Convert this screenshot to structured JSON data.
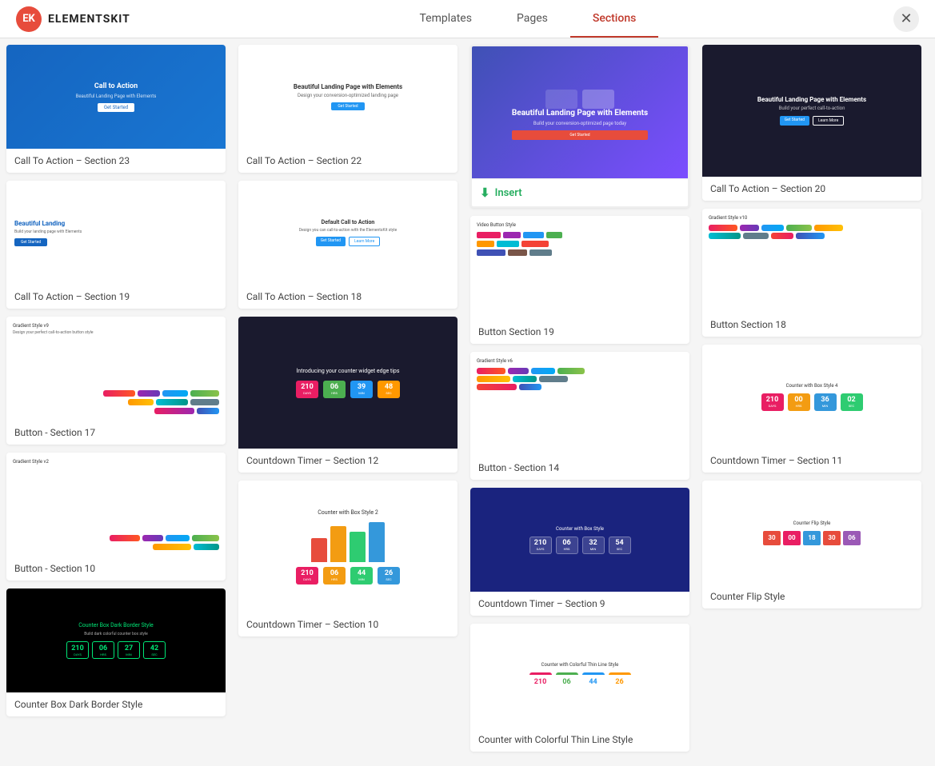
{
  "header": {
    "logo_text": "ELEMENTSKIT",
    "logo_icon": "EK",
    "nav_tabs": [
      {
        "label": "Templates",
        "id": "templates",
        "active": false
      },
      {
        "label": "Pages",
        "id": "pages",
        "active": false
      },
      {
        "label": "Sections",
        "id": "sections",
        "active": true
      }
    ]
  },
  "insert_label": "Insert",
  "columns": {
    "col1": {
      "cards": [
        {
          "id": "cta23",
          "label": "Call To Action – Section 23"
        },
        {
          "id": "cta19l",
          "label": "Call To Action – Section 19"
        },
        {
          "id": "btn17",
          "label": "Button - Section 17"
        },
        {
          "id": "btn10",
          "label": "Button - Section 10"
        },
        {
          "id": "cnt-dark",
          "label": "Counter Box Dark Border Style"
        }
      ]
    },
    "col2": {
      "cards": [
        {
          "id": "cta22",
          "label": "Call To Action – Section 22"
        },
        {
          "id": "cta18l",
          "label": "Call To Action – Section 18"
        },
        {
          "id": "cnt12",
          "label": "Countdown Timer – Section 12"
        },
        {
          "id": "cnt10",
          "label": "Countdown Timer – Section 10"
        }
      ]
    },
    "col3": {
      "cards": [
        {
          "id": "cta-main",
          "label": "",
          "highlighted": true,
          "show_insert": true
        },
        {
          "id": "btn19",
          "label": "Button Section 19"
        },
        {
          "id": "btn14",
          "label": "Button - Section 14"
        },
        {
          "id": "cnt9",
          "label": "Countdown Timer – Section 9"
        },
        {
          "id": "cnt-thin",
          "label": "Counter with Colorful Thin Line Style"
        }
      ]
    },
    "col4": {
      "cards": [
        {
          "id": "cta20",
          "label": "Call To Action – Section 20"
        },
        {
          "id": "btn18r",
          "label": "Button Section 18"
        },
        {
          "id": "cnt11",
          "label": "Countdown Timer – Section 11"
        },
        {
          "id": "cnt-flip",
          "label": "Counter Flip Style"
        }
      ]
    }
  }
}
